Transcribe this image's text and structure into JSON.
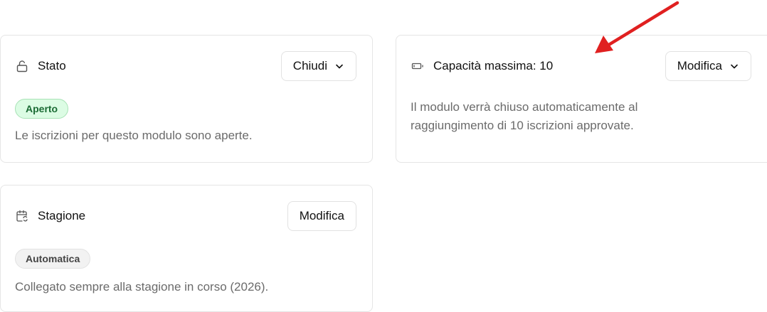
{
  "cards": {
    "stato": {
      "title": "Stato",
      "button_label": "Chiudi",
      "badge": "Aperto",
      "description": "Le iscrizioni per questo modulo sono aperte."
    },
    "capacita": {
      "title": "Capacità massima: 10",
      "button_label": "Modifica",
      "description": "Il modulo verrà chiuso automaticamente al raggiungimento di 10 iscrizioni approvate."
    },
    "stagione": {
      "title": "Stagione",
      "button_label": "Modifica",
      "badge": "Automatica",
      "description": "Collegato sempre alla stagione in corso (2026)."
    }
  },
  "icons": {
    "stato": "lock-open-icon",
    "capacita": "battery-icon",
    "stagione": "calendar-sync-icon",
    "dropdown": "chevron-down-icon"
  },
  "colors": {
    "badge_green_bg": "#dcfce4",
    "badge_green_text": "#1b6b34",
    "badge_gray_bg": "#f2f2f2",
    "annotation_arrow": "#e02020"
  }
}
